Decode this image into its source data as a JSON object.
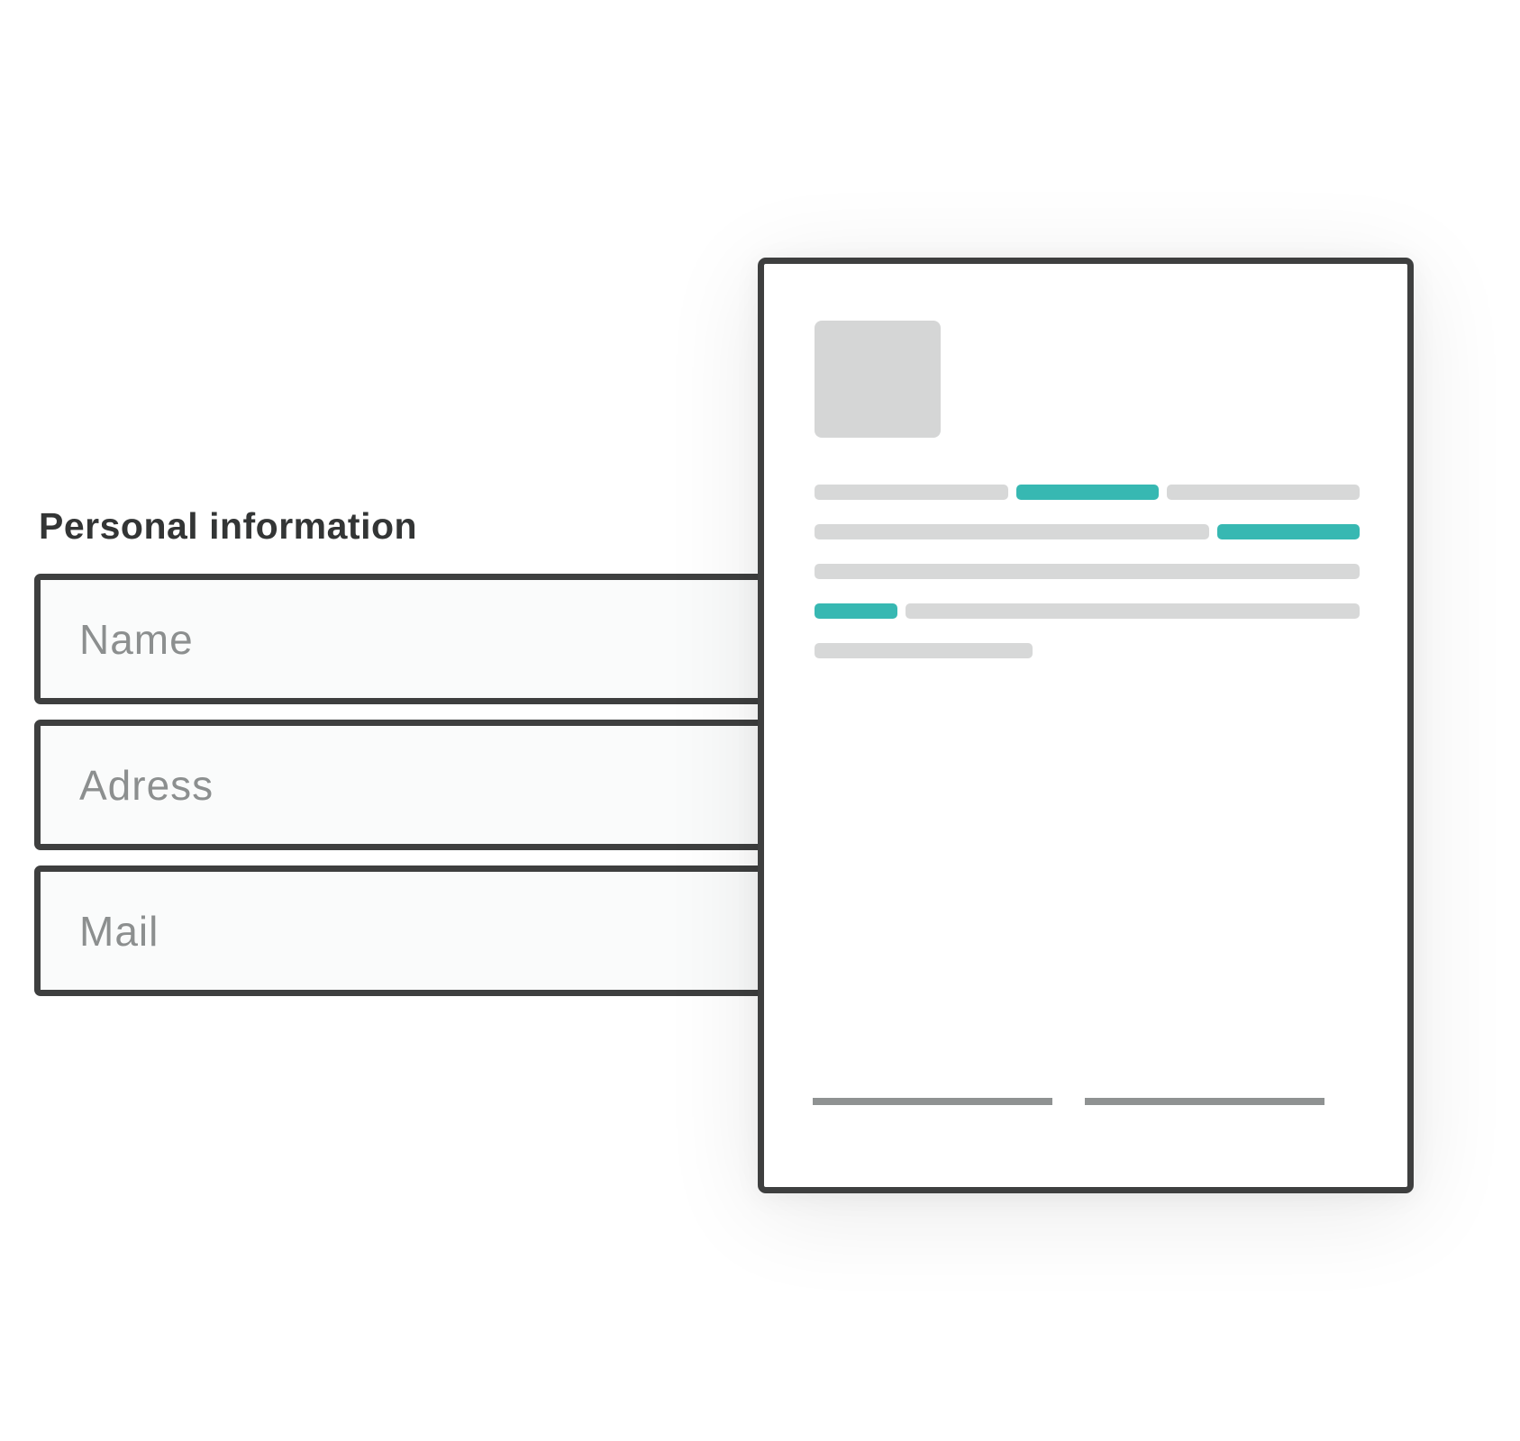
{
  "section": {
    "title": "Personal information"
  },
  "fields": [
    {
      "placeholder": "Name"
    },
    {
      "placeholder": "Adress"
    },
    {
      "placeholder": "Mail"
    }
  ],
  "colors": {
    "accent": "#37b8b2",
    "text_line": "#d7d8d8",
    "border": "#3e3f3f",
    "signature_line": "#8f9292"
  }
}
